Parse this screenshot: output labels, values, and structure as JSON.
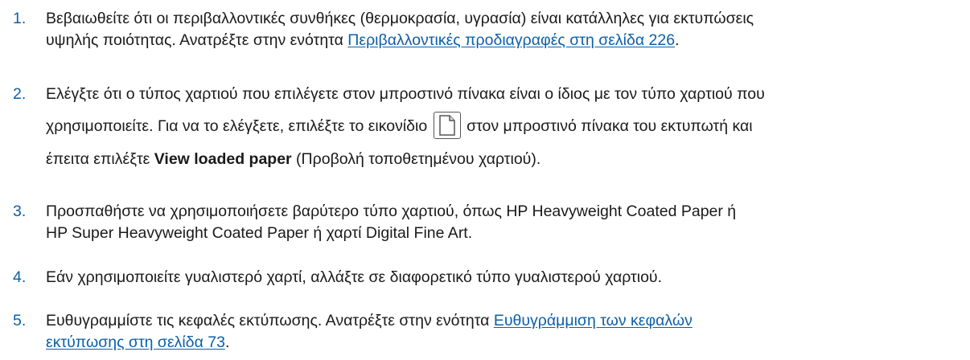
{
  "steps": [
    {
      "number": "1.",
      "line1": "Βεβαιωθείτε ότι οι περιβαλλοντικές συνθήκες (θερμοκρασία, υγρασία) είναι κατάλληλες για εκτυπώσεις",
      "line2_prefix": "υψηλής ποιότητας. Ανατρέξτε στην ενότητα ",
      "link": "Περιβαλλοντικές προδιαγραφές στη σελίδα 226",
      "line2_suffix": "."
    },
    {
      "number": "2.",
      "line1": "Ελέγξτε ότι ο τύπος χαρτιού που επιλέγετε στον μπροστινό πίνακα είναι ο ίδιος με τον τύπο χαρτιού που",
      "line2_prefix": "χρησιμοποιείτε. Για να το ελέγξετε, επιλέξτε το εικονίδιο",
      "icon": "paper-icon",
      "line2_suffix": "στον μπροστινό πίνακα του εκτυπωτή και",
      "line3_prefix": "έπειτα επιλέξτε ",
      "bold": "View loaded paper",
      "line3_suffix": " (Προβολή τοποθετημένου χαρτιού)."
    },
    {
      "number": "3.",
      "line1": "Προσπαθήστε να χρησιμοποιήσετε βαρύτερο τύπο χαρτιού, όπως HP Heavyweight Coated Paper ή",
      "line2": "HP Super Heavyweight Coated Paper ή χαρτί Digital Fine Art."
    },
    {
      "number": "4.",
      "line1": "Εάν χρησιμοποιείτε γυαλιστερό χαρτί, αλλάξτε σε διαφορετικό τύπο γυαλιστερού χαρτιού."
    },
    {
      "number": "5.",
      "line1_prefix": "Ευθυγραμμίστε τις κεφαλές εκτύπωσης. Ανατρέξτε στην ενότητα ",
      "link_part1": "Ευθυγράμμιση των κεφαλών",
      "link_part2": "εκτύπωσης στη σελίδα 73",
      "line2_suffix": "."
    }
  ],
  "colors": {
    "number": "#0c5fa8",
    "link": "#0c5fa8",
    "text": "#1a1a1a"
  }
}
